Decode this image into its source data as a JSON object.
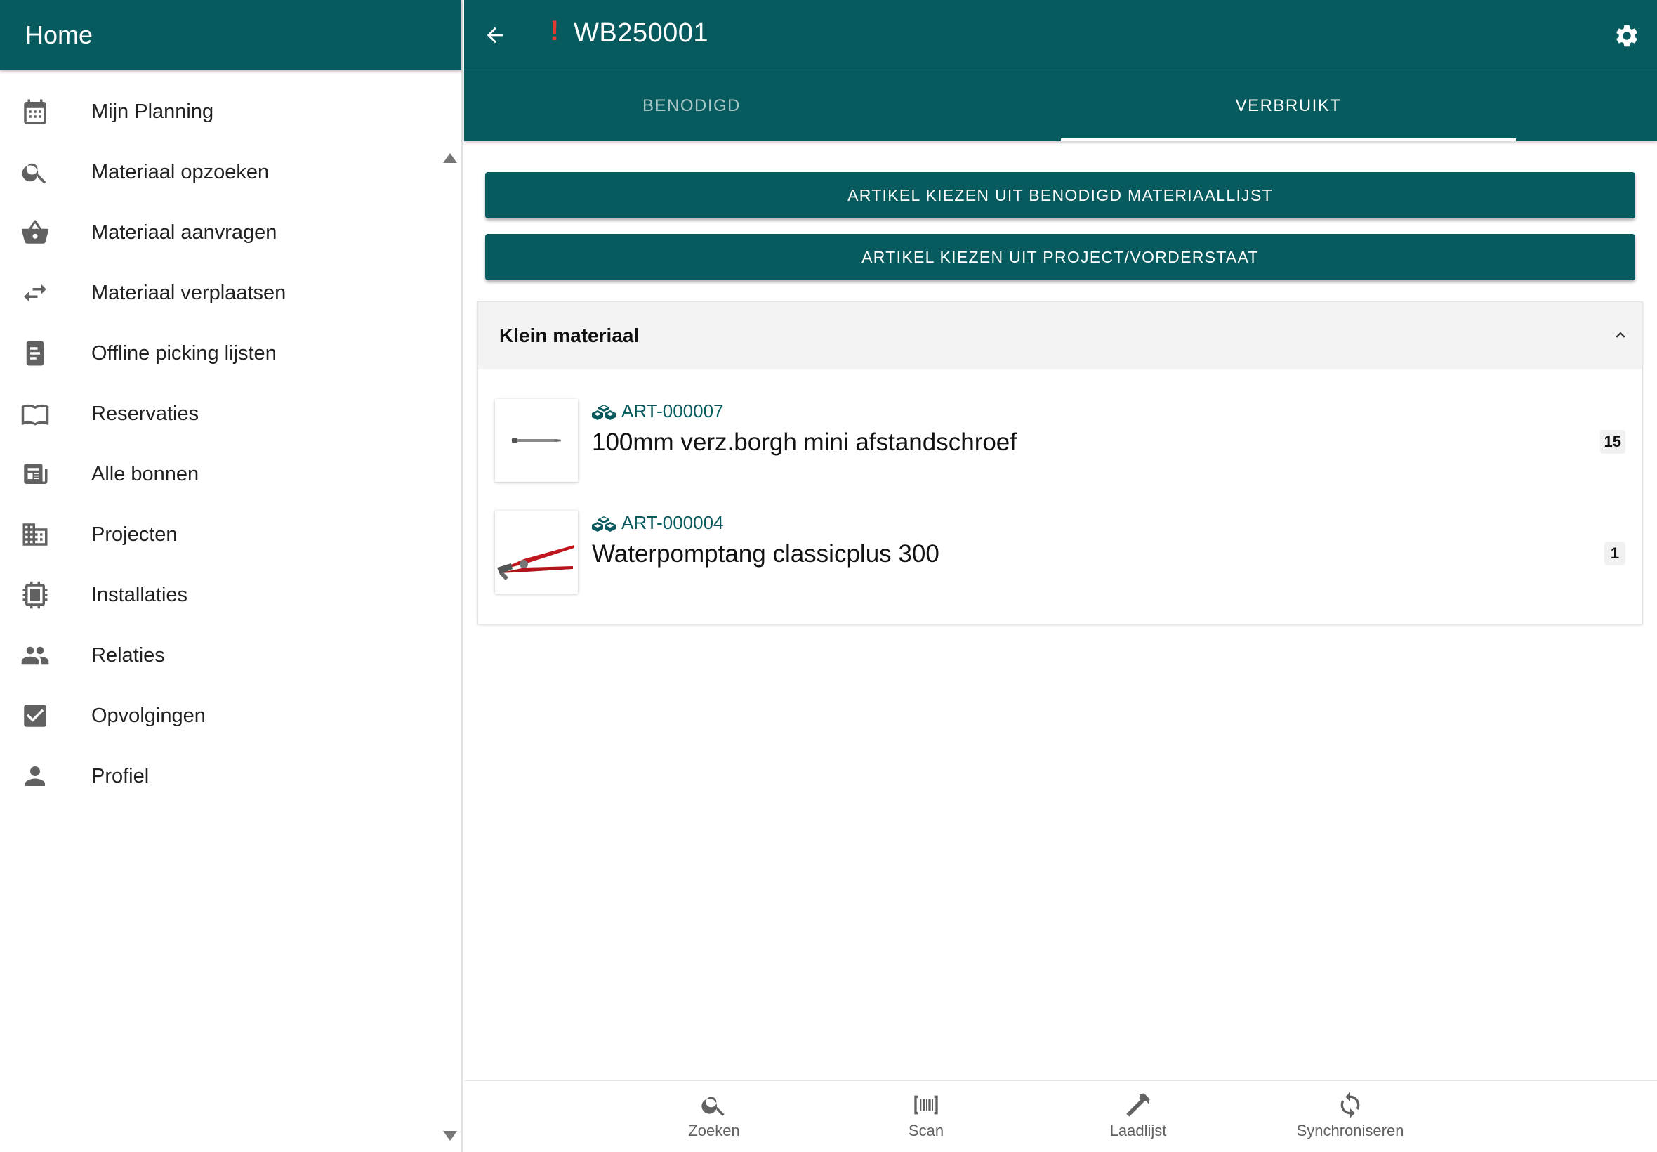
{
  "sidebar": {
    "title": "Home",
    "items": [
      {
        "label": "Mijn Planning",
        "icon": "calendar-icon"
      },
      {
        "label": "Materiaal opzoeken",
        "icon": "search-icon"
      },
      {
        "label": "Materiaal aanvragen",
        "icon": "basket-icon"
      },
      {
        "label": "Materiaal verplaatsen",
        "icon": "swap-arrows-icon"
      },
      {
        "label": "Offline picking lijsten",
        "icon": "document-icon"
      },
      {
        "label": "Reservaties",
        "icon": "book-open-icon"
      },
      {
        "label": "Alle bonnen",
        "icon": "newspaper-icon"
      },
      {
        "label": "Projecten",
        "icon": "building-icon"
      },
      {
        "label": "Installaties",
        "icon": "chip-icon"
      },
      {
        "label": "Relaties",
        "icon": "people-icon"
      },
      {
        "label": "Opvolgingen",
        "icon": "checkbox-icon"
      },
      {
        "label": "Profiel",
        "icon": "person-icon"
      }
    ]
  },
  "header": {
    "alert": "!",
    "title": "WB250001"
  },
  "tabs": [
    {
      "label": "BENODIGD",
      "active": false
    },
    {
      "label": "VERBRUIKT",
      "active": true
    }
  ],
  "actions": {
    "pick_from_required": "ARTIKEL KIEZEN UIT BENODIGD MATERIAALLIJST",
    "pick_from_project": "ARTIKEL KIEZEN UIT PROJECT/VORDERSTAAT"
  },
  "section": {
    "title": "Klein materiaal",
    "items": [
      {
        "code": "ART-000007",
        "name": "100mm verz.borgh mini afstandschroef",
        "qty": "15"
      },
      {
        "code": "ART-000004",
        "name": "Waterpomptang classicplus 300",
        "qty": "1"
      }
    ]
  },
  "bottom_nav": [
    {
      "label": "Zoeken",
      "icon": "search-icon"
    },
    {
      "label": "Scan",
      "icon": "barcode-scan-icon"
    },
    {
      "label": "Laadlijst",
      "icon": "hammer-icon"
    },
    {
      "label": "Synchroniseren",
      "icon": "sync-icon"
    }
  ],
  "colors": {
    "primary": "#075b5e",
    "alert": "#e53935",
    "icon_grey": "#616161"
  }
}
